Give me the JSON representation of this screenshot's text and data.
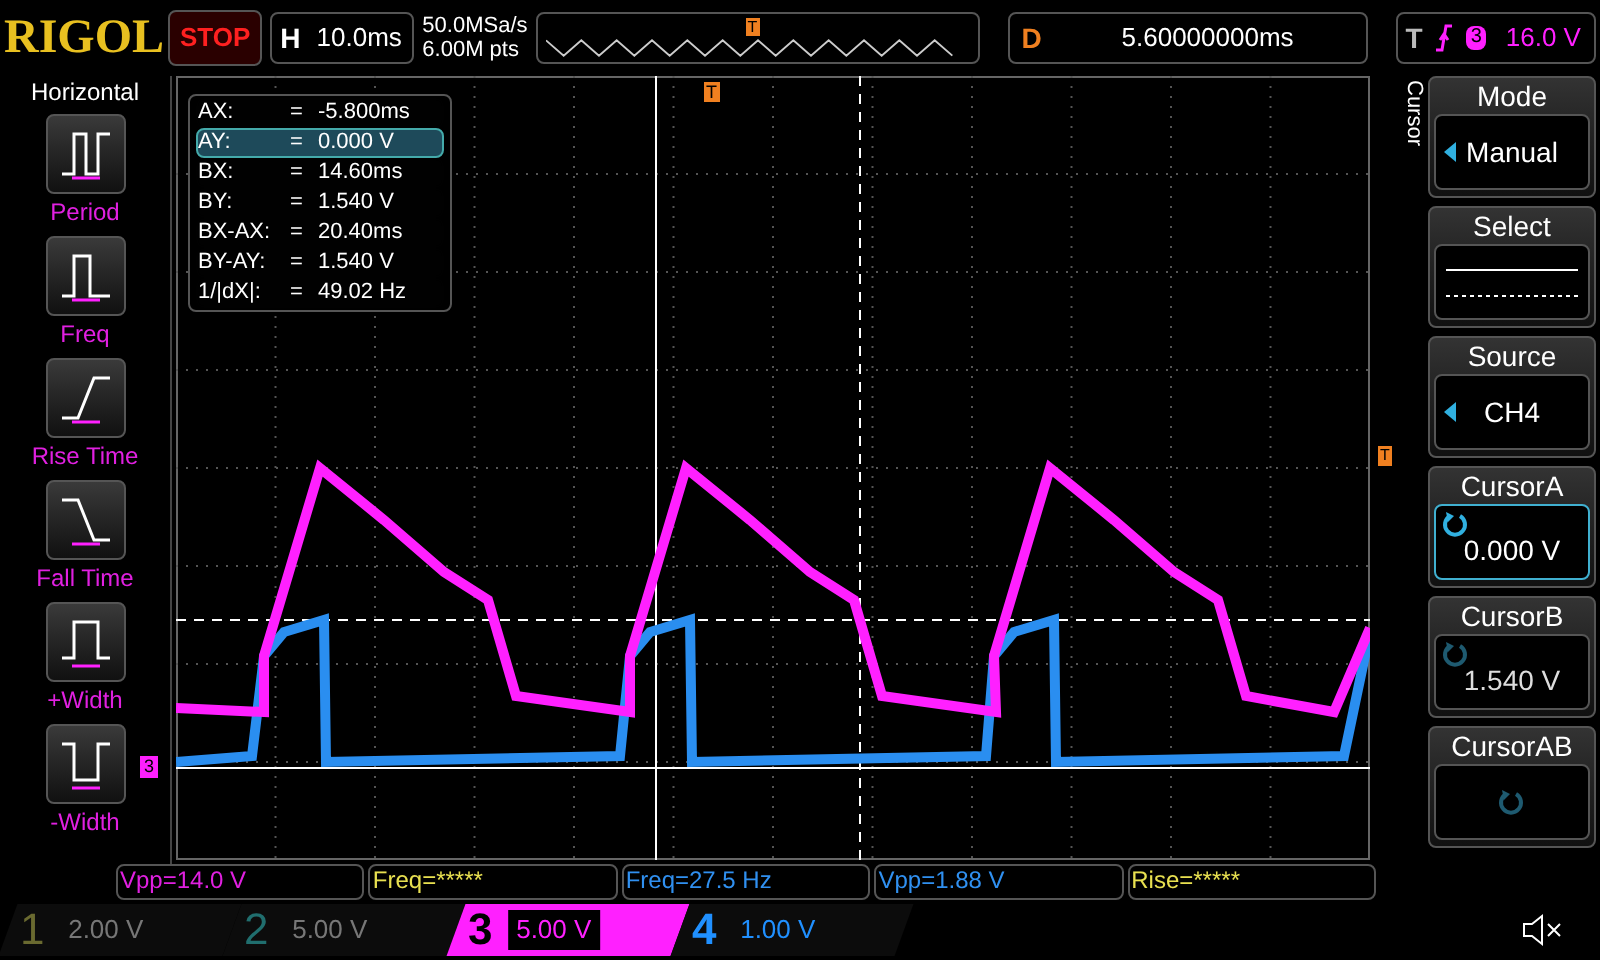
{
  "top_bar": {
    "brand": "RIGOL",
    "run_state": "STOP",
    "timebase_label": "H",
    "timebase": "10.0ms",
    "sample_rate": "50.0MSa/s",
    "memory_depth": "6.00M pts",
    "trigger_position": "T",
    "delay_label": "D",
    "delay": "5.60000000ms",
    "trigger_label": "T",
    "trigger_source": "3",
    "trigger_level": "16.0 V"
  },
  "left_panel": {
    "title": "Horizontal",
    "items": [
      {
        "kind": "period",
        "label": "Period"
      },
      {
        "kind": "freq",
        "label": "Freq"
      },
      {
        "kind": "rise",
        "label": "Rise Time"
      },
      {
        "kind": "fall",
        "label": "Fall Time"
      },
      {
        "kind": "pwidth",
        "label": "+Width"
      },
      {
        "kind": "nwidth",
        "label": "-Width"
      }
    ]
  },
  "cursor_readout": [
    {
      "label": "AX:",
      "eq": "=",
      "value": "-5.800ms",
      "selected": false
    },
    {
      "label": "AY:",
      "eq": "=",
      "value": "0.000 V",
      "selected": true
    },
    {
      "label": "BX:",
      "eq": "=",
      "value": "14.60ms",
      "selected": false
    },
    {
      "label": "BY:",
      "eq": "=",
      "value": "1.540 V",
      "selected": false
    },
    {
      "label": "BX-AX:",
      "eq": "=",
      "value": "20.40ms",
      "selected": false
    },
    {
      "label": "BY-AY:",
      "eq": "=",
      "value": "1.540 V",
      "selected": false
    },
    {
      "label": "1/|dX|:",
      "eq": "=",
      "value": "49.02 Hz",
      "selected": false
    }
  ],
  "plot": {
    "trigger_marker": "T",
    "channel_marker": "3",
    "level_marker": "T"
  },
  "right_menu": {
    "title": "Cursor",
    "items": [
      {
        "kind": "choice",
        "title": "Mode",
        "value": "Manual",
        "selected": false
      },
      {
        "kind": "lines",
        "title": "Select",
        "selected": false
      },
      {
        "kind": "choice",
        "title": "Source",
        "value": "CH4",
        "selected": false
      },
      {
        "kind": "knob",
        "title": "CursorA",
        "value": "0.000 V",
        "selected": true
      },
      {
        "kind": "knob",
        "title": "CursorB",
        "value": "1.540 V",
        "selected": false
      },
      {
        "kind": "knob",
        "title": "CursorAB",
        "selected": false
      }
    ]
  },
  "measurements": [
    {
      "text": "Vpp=14.0 V",
      "color": "#e020e0"
    },
    {
      "text": "Freq=*****",
      "color": "#e8e050"
    },
    {
      "text": "Freq=27.5 Hz",
      "color": "#3090f0"
    },
    {
      "text": "Vpp=1.88 V",
      "color": "#3090f0"
    },
    {
      "text": "Rise=*****",
      "color": "#e8e050"
    }
  ],
  "channels": [
    {
      "number": "1",
      "scale": "2.00 V",
      "color": "#6a6a30",
      "on": false,
      "selected": false
    },
    {
      "number": "2",
      "scale": "5.00 V",
      "color": "#206e6e",
      "on": false,
      "selected": false
    },
    {
      "number": "3",
      "scale": "5.00 V",
      "color": "#ff20ff",
      "on": true,
      "selected": true
    },
    {
      "number": "4",
      "scale": "1.00 V",
      "color": "#2090ff",
      "on": true,
      "selected": false
    }
  ]
}
